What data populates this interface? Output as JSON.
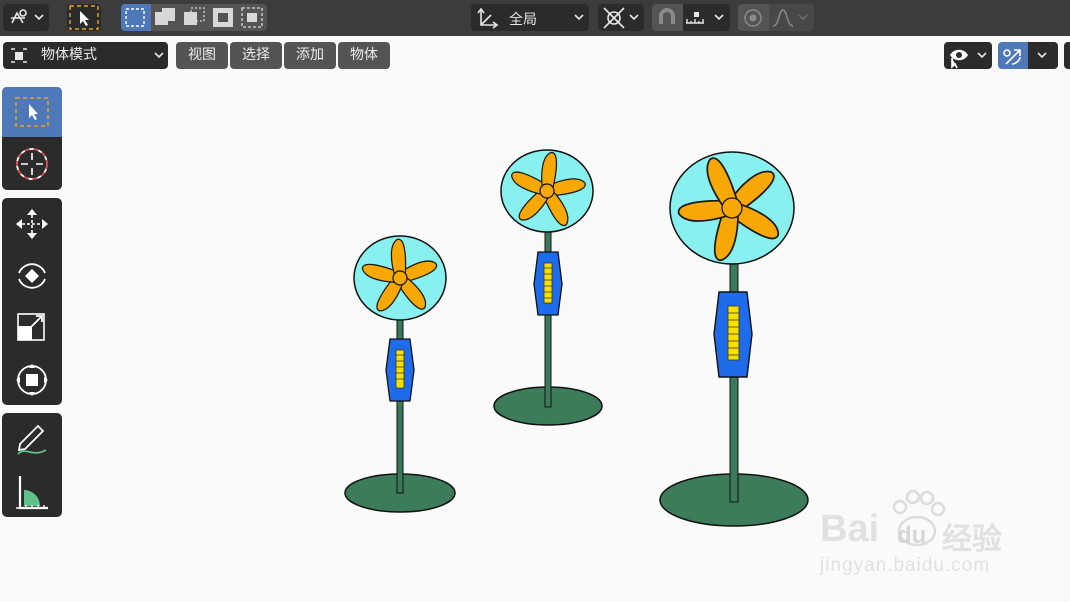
{
  "header": {
    "transform_orientation": "全局",
    "mode": "物体模式",
    "menus": [
      "视图",
      "选择",
      "添加",
      "物体"
    ]
  },
  "toolbar": {
    "groups": [
      [
        "select-box-tool",
        "cursor-tool"
      ],
      [
        "move-tool",
        "rotate-tool",
        "scale-tool",
        "transform-tool"
      ],
      [
        "annotate-tool",
        "measure-tool"
      ]
    ]
  },
  "scene": {
    "objects": [
      "fan-small",
      "fan-medium",
      "fan-large"
    ],
    "colors": {
      "fan_head": "#88f0ee",
      "blade": "#f7a805",
      "pole": "#3a7a5a",
      "base": "#3d7c5a",
      "control_box": "#1f6cea",
      "buttons": "#f7e000"
    }
  },
  "watermark": {
    "brand_latin": "Bai",
    "brand_latin2": "du",
    "brand_cn": "经验",
    "url": "jingyan.baidu.com"
  },
  "colors": {
    "header_bg": "#3c3c3c",
    "button_bg": "#2b2b2b",
    "accent": "#4f78b8",
    "viewport_bg": "#fafafa"
  }
}
